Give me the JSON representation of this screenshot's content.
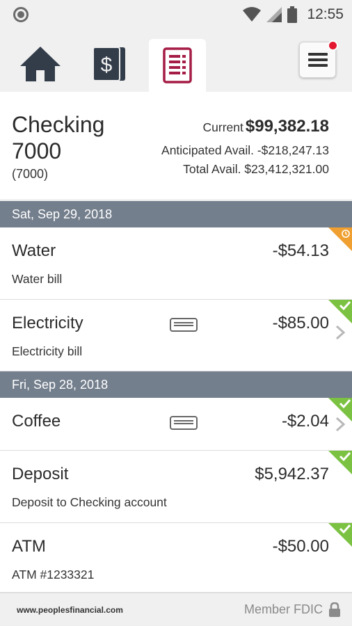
{
  "status_bar": {
    "time": "12:55"
  },
  "tabs": [
    {
      "id": "home",
      "icon": "home-icon"
    },
    {
      "id": "accounts",
      "icon": "dollar-bill-icon"
    },
    {
      "id": "activity",
      "icon": "ledger-icon",
      "selected": true
    }
  ],
  "menu": {
    "icon": "hamburger-menu-icon",
    "has_notification": true
  },
  "account": {
    "name": "Checking 7000",
    "number": "(7000)",
    "current_label": "Current",
    "current_value": "$99,382.18",
    "anticipated_line": "Anticipated Avail. -$218,247.13",
    "total_line": "Total Avail. $23,412,321.00"
  },
  "groups": [
    {
      "date": "Sat, Sep 29, 2018",
      "transactions": [
        {
          "name": "Water",
          "description": "Water bill",
          "amount": "-$54.13",
          "status": "pending"
        },
        {
          "name": "Electricity",
          "description": "Electricity bill",
          "amount": "-$85.00",
          "status": "cleared",
          "receipt": true,
          "chevron": true
        }
      ]
    },
    {
      "date": "Fri, Sep 28, 2018",
      "transactions": [
        {
          "name": "Coffee",
          "description": "",
          "amount": "-$2.04",
          "status": "cleared",
          "receipt": true,
          "chevron": true
        },
        {
          "name": "Deposit",
          "description": "Deposit to Checking account",
          "amount": "$5,942.37",
          "status": "cleared"
        },
        {
          "name": "ATM",
          "description": "ATM #1233321",
          "amount": "-$50.00",
          "status": "cleared"
        }
      ]
    }
  ],
  "footer": {
    "url": "www.peoplesfinancial.com",
    "fdic": "Member FDIC"
  },
  "colors": {
    "accent": "#a51c46",
    "date_bar": "#747f8d",
    "cleared": "#7cc242",
    "pending": "#f0a030",
    "notification": "#e3172f"
  }
}
